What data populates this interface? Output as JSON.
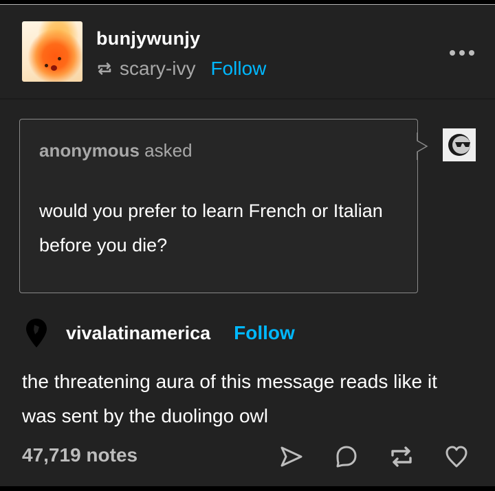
{
  "post": {
    "author": "bunjywunjy",
    "reblogged_from": "scary-ivy",
    "follow_label": "Follow",
    "more_icon": "ellipsis-icon",
    "ask": {
      "asker": "anonymous",
      "asked_label": "asked",
      "question": "would you prefer to learn French or Italian before you die?",
      "asker_avatar_icon": "sunglasses-moon-icon"
    },
    "reblog": {
      "username": "vivalatinamerica",
      "follow_label": "Follow",
      "avatar_icon": "map-pin-icon",
      "text": "the threatening aura of this message reads like it was sent by the duolingo owl"
    },
    "footer": {
      "notes": "47,719 notes",
      "actions": [
        {
          "name": "share",
          "icon": "send-icon"
        },
        {
          "name": "reply",
          "icon": "comment-icon"
        },
        {
          "name": "reblog",
          "icon": "reblog-icon"
        },
        {
          "name": "like",
          "icon": "heart-icon"
        }
      ]
    }
  },
  "colors": {
    "background": "#222222",
    "accent": "#00b8ff",
    "muted_text": "#a8a8a8"
  }
}
